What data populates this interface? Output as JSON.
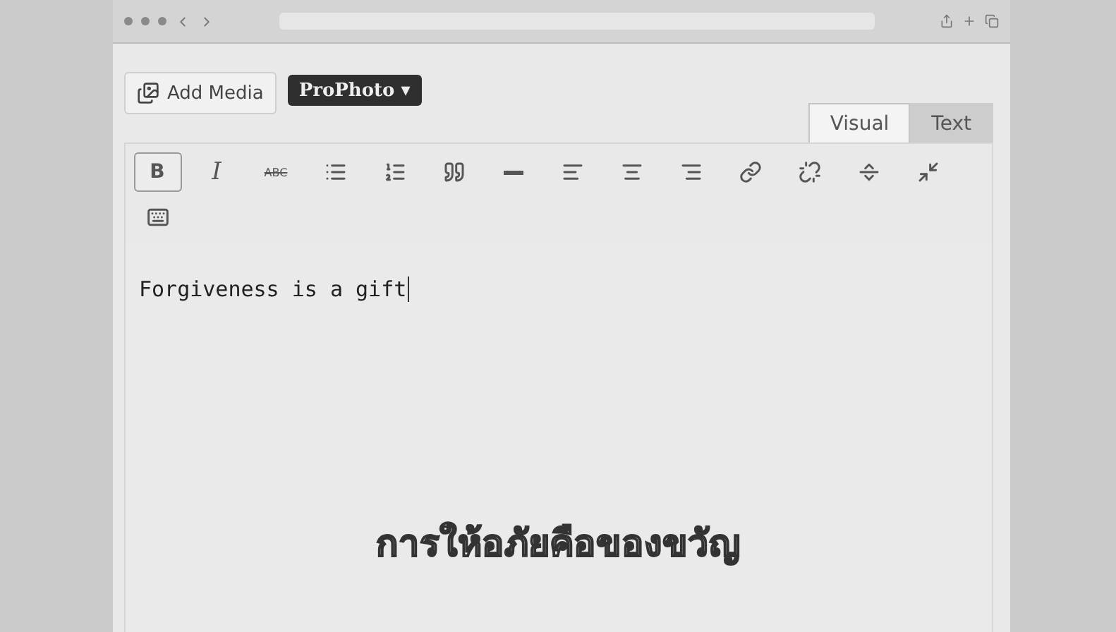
{
  "browser": {
    "address_field": {
      "kind": "field"
    }
  },
  "editor": {
    "add_media": "Add Media",
    "prophoto": "ProPhoto ▾",
    "tabs": [
      {
        "label": "Visual",
        "selected": true
      },
      {
        "label": "Text",
        "selected": false
      }
    ],
    "toolbar": [
      {
        "kind": "text",
        "label": "B",
        "active": true
      },
      {
        "kind": "text",
        "label": "I",
        "active": false
      },
      {
        "kind": "text",
        "label": "ABC",
        "active": false
      },
      {
        "kind": "icon",
        "active": false
      },
      {
        "kind": "icon",
        "active": false
      },
      {
        "kind": "icon",
        "active": false
      },
      {
        "kind": "icon",
        "active": false
      },
      {
        "kind": "icon",
        "active": false
      },
      {
        "kind": "icon",
        "active": false
      },
      {
        "kind": "icon",
        "active": false
      },
      {
        "kind": "icon",
        "active": false
      },
      {
        "kind": "icon",
        "active": false
      },
      {
        "kind": "icon",
        "active": false
      },
      {
        "kind": "icon",
        "active": false
      },
      {
        "kind": "icon",
        "active": false
      }
    ],
    "content": "Forgiveness is a gift"
  },
  "subtitle": "การให้อภัยคือของขวัญ"
}
